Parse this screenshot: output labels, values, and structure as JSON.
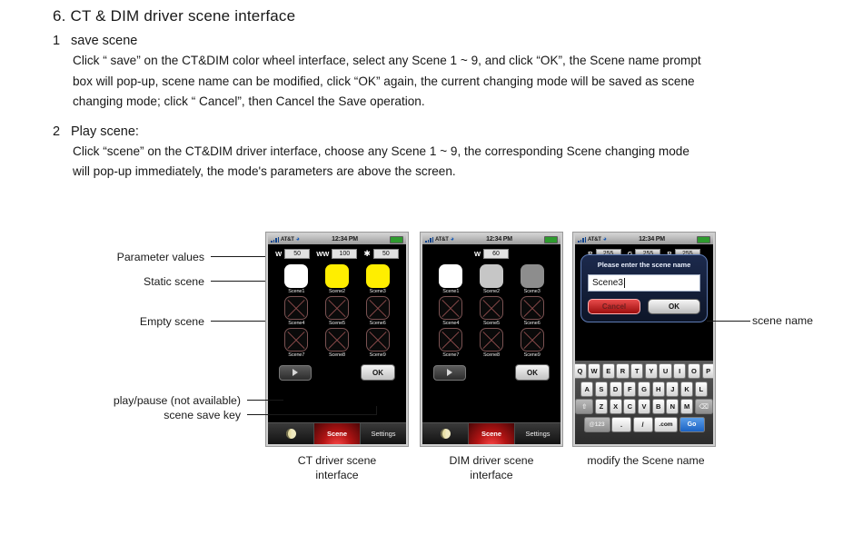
{
  "document": {
    "heading": "6. CT & DIM driver scene interface",
    "sections": [
      {
        "number": "1",
        "title": "save scene",
        "paragraphs": [
          "Click “ save” on the CT&DIM color wheel interface, select any Scene 1 ~ 9, and click “OK”, the Scene name prompt",
          "box will pop-up, scene name can be modified, click “OK” again, the current changing mode will be saved  as scene",
          "changing mode; click “ Cancel”, then Cancel the Save operation."
        ]
      },
      {
        "number": "2",
        "title": "Play scene:",
        "paragraphs": [
          "Click “scene” on the CT&DIM driver interface, choose any Scene 1 ~ 9, the corresponding Scene changing mode",
          "will pop-up immediately, the mode's parameters are above the screen."
        ]
      }
    ]
  },
  "callouts": {
    "parameter_values": "Parameter values",
    "static_scene": "Static scene",
    "empty_scene": "Empty scene",
    "play_pause": "play/pause (not available)",
    "scene_save_key": "scene save key",
    "scene_name": "scene name"
  },
  "captions": {
    "ct": "CT driver scene\ninterface",
    "ct_line1": "CT driver scene",
    "ct_line2": "interface",
    "dim_line1": "DIM driver scene",
    "dim_line2": "interface",
    "modify": "modify the Scene name"
  },
  "statusbar": {
    "carrier": "AT&T",
    "clock": "12:34 PM",
    "wifi_icon": "wifi-icon",
    "signal_icon": "signal-bars-icon",
    "battery_icon": "battery-icon"
  },
  "phone_ct": {
    "params": [
      {
        "label": "W",
        "value": "50"
      },
      {
        "label": "WW",
        "value": "100"
      },
      {
        "label": "✱",
        "value": "50",
        "is_icon": true
      }
    ],
    "scenes": [
      {
        "label": "Scene1",
        "state": "white"
      },
      {
        "label": "Scene2",
        "state": "yellow"
      },
      {
        "label": "Scene3",
        "state": "yellow"
      },
      {
        "label": "Scene4",
        "state": "empty"
      },
      {
        "label": "Scene5",
        "state": "empty"
      },
      {
        "label": "Scene6",
        "state": "empty"
      },
      {
        "label": "Scene7",
        "state": "empty"
      },
      {
        "label": "Scene8",
        "state": "empty"
      },
      {
        "label": "Scene9",
        "state": "empty"
      }
    ],
    "ok_label": "OK",
    "play_icon": "play-icon",
    "tabs": [
      {
        "label": "",
        "icon": "moon-icon",
        "active": false
      },
      {
        "label": "Scene",
        "active": true
      },
      {
        "label": "Settings",
        "active": false
      }
    ]
  },
  "phone_dim": {
    "params": [
      {
        "label": "W",
        "value": "60"
      }
    ],
    "scenes": [
      {
        "label": "Scene1",
        "state": "white"
      },
      {
        "label": "Scene2",
        "state": "lgray"
      },
      {
        "label": "Scene3",
        "state": "gray"
      },
      {
        "label": "Scene4",
        "state": "empty"
      },
      {
        "label": "Scene5",
        "state": "empty"
      },
      {
        "label": "Scene6",
        "state": "empty"
      },
      {
        "label": "Scene7",
        "state": "empty"
      },
      {
        "label": "Scene8",
        "state": "empty"
      },
      {
        "label": "Scene9",
        "state": "empty"
      }
    ],
    "ok_label": "OK",
    "play_icon": "play-icon",
    "tabs": [
      {
        "label": "",
        "icon": "moon-icon",
        "active": false
      },
      {
        "label": "Scene",
        "active": true
      },
      {
        "label": "Settings",
        "active": false
      }
    ]
  },
  "phone_name": {
    "params": [
      {
        "label": "R",
        "value": "255"
      },
      {
        "label": "G",
        "value": "255"
      },
      {
        "label": "B",
        "value": "255"
      }
    ],
    "dialog": {
      "title": "Please enter the scene name",
      "input_value": "Scene3",
      "cancel_label": "Cancel",
      "ok_label": "OK"
    },
    "keyboard": {
      "row1": [
        "Q",
        "W",
        "E",
        "R",
        "T",
        "Y",
        "U",
        "I",
        "O",
        "P"
      ],
      "row2": [
        "A",
        "S",
        "D",
        "F",
        "G",
        "H",
        "J",
        "K",
        "L"
      ],
      "row3": [
        "Z",
        "X",
        "C",
        "V",
        "B",
        "N",
        "M"
      ],
      "shift_label": "⇧",
      "backspace_label": "⌫",
      "num_label": "@123",
      "dot_label": ".",
      "slash_label": "/",
      "dotcom_label": ".com",
      "go_label": "Go"
    }
  },
  "colors": {
    "accent_red": "#b41414",
    "go_blue": "#1c63c4",
    "yellow": "#ffee00",
    "battery_green": "#2f9b2f"
  }
}
